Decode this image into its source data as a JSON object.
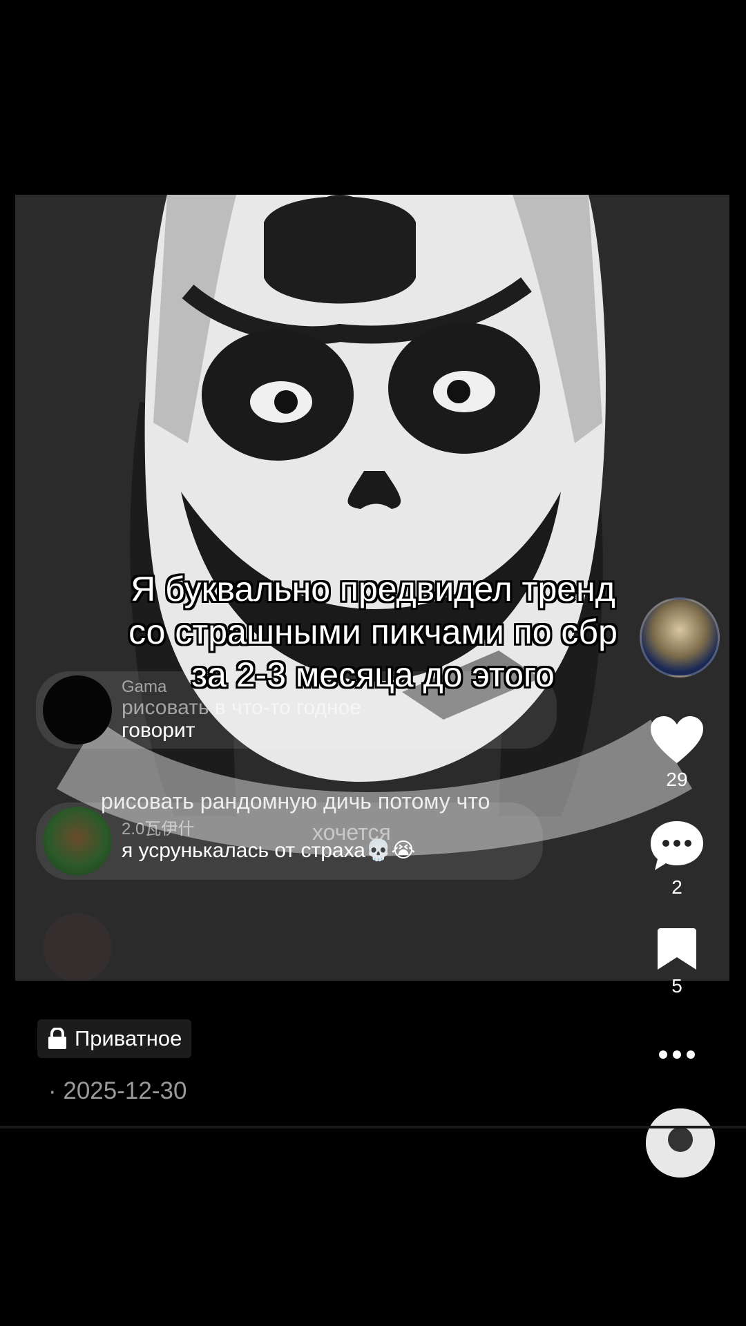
{
  "caption": {
    "lines": [
      "Я буквально предвидел тренд",
      "со страшными пикчами по сбр",
      "за 2-3 месяца до этого"
    ]
  },
  "embedded_comments": {
    "first": {
      "username": "Gama",
      "partial_text": "рисовать в что-то годное",
      "line2": "говорит"
    },
    "overlay_line": "рисовать рандомную дичь потому что",
    "overlay_line2": "хочется",
    "second": {
      "username": "2.0瓦伊什",
      "text": "я усрунькалась от страха💀😭"
    }
  },
  "actions": {
    "likes": "29",
    "comments": "2",
    "saves": "5"
  },
  "icons": {
    "like": "heart-icon",
    "comment": "comment-bubble-icon",
    "save": "bookmark-icon",
    "more": "more-dots-icon",
    "lock": "lock-icon"
  },
  "post": {
    "privacy_label": "Приватное",
    "date": "· 2025-12-30"
  }
}
